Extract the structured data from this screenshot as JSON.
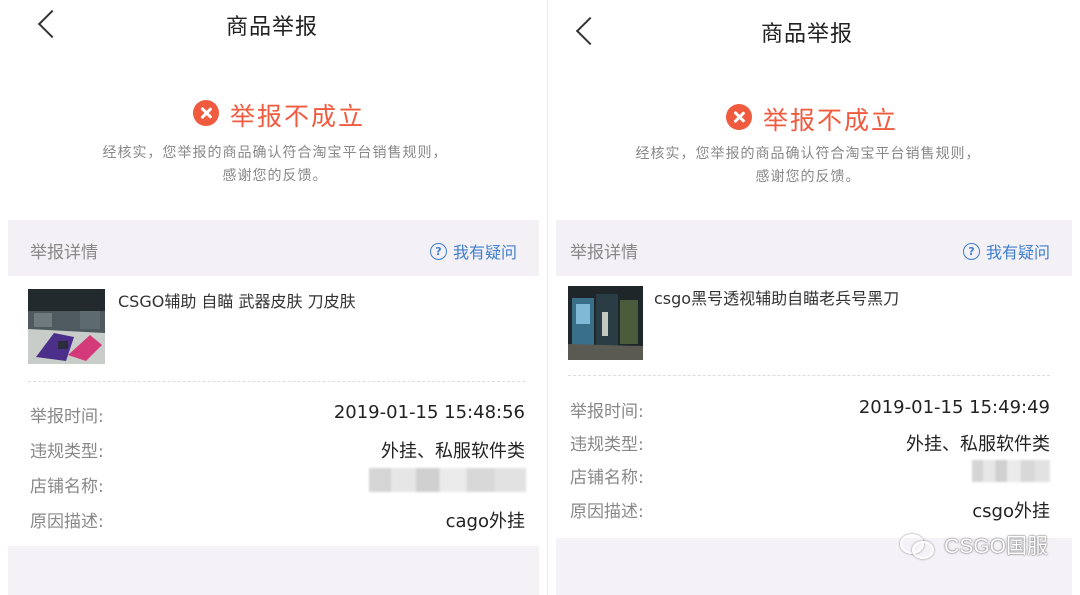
{
  "panels": [
    {
      "title": "商品举报",
      "status": "举报不成立",
      "note_line1": "经核实，您举报的商品确认符合淘宝平台销售规则，",
      "note_line2": "感谢您的反馈。",
      "details_label": "举报详情",
      "question_label": "我有疑问",
      "product_name": "CSGO辅助 自瞄 武器皮肤 刀皮肤",
      "rows": [
        {
          "label": "举报时间:",
          "value": "2019-01-15 15:48:56"
        },
        {
          "label": "违规类型:",
          "value": "外挂、私服软件类"
        },
        {
          "label": "店铺名称:",
          "value": ""
        },
        {
          "label": "原因描述:",
          "value": "cago外挂"
        }
      ]
    },
    {
      "title": "商品举报",
      "status": "举报不成立",
      "note_line1": "经核实，您举报的商品确认符合淘宝平台销售规则，",
      "note_line2": "感谢您的反馈。",
      "details_label": "举报详情",
      "question_label": "我有疑问",
      "product_name": "csgo黑号透视辅助自瞄老兵号黑刀",
      "rows": [
        {
          "label": "举报时间:",
          "value": "2019-01-15 15:49:49"
        },
        {
          "label": "违规类型:",
          "value": "外挂、私服软件类"
        },
        {
          "label": "店铺名称:",
          "value": ""
        },
        {
          "label": "原因描述:",
          "value": "csgo外挂"
        }
      ]
    }
  ],
  "watermark": "CSGO国服",
  "colors": {
    "status": "#f05a3e",
    "link": "#3f7fce",
    "band": "#f3f1f5"
  },
  "icons": [
    "chevron-left-icon",
    "error-x-icon",
    "question-circle-icon",
    "wechat-icon"
  ]
}
